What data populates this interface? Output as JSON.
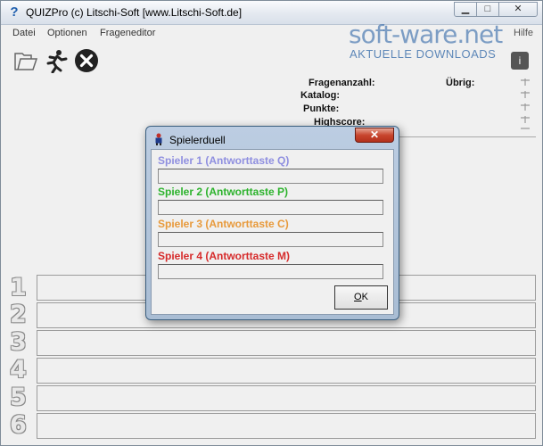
{
  "window": {
    "title": "QUIZPro (c) Litschi-Soft [www.Litschi-Soft.de]",
    "minimize_glyph": "▁",
    "maximize_glyph": "□",
    "close_glyph": "✕"
  },
  "menu": [
    "Datei",
    "Optionen",
    "Frageneditor"
  ],
  "help_menu_partial": "Hilfe",
  "watermark": {
    "brand": "soft-ware.net",
    "tagline": "AKTUELLE DOWNLOADS"
  },
  "stats": {
    "fragenanzahl": "Fragenanzahl:",
    "uebrig": "Übrig:",
    "katalog": "Katalog:",
    "punkte": "Punkte:",
    "highscore": "Highscore:"
  },
  "rows": [
    "1",
    "2",
    "3",
    "4",
    "5",
    "6"
  ],
  "dialog": {
    "title": "Spielerduell",
    "close_glyph": "✕",
    "players": [
      {
        "label": "Spieler 1 (Antworttaste Q)",
        "value": "",
        "color": "#8f8fe0"
      },
      {
        "label": "Spieler 2 (Antworttaste P)",
        "value": "",
        "color": "#2db32d"
      },
      {
        "label": "Spieler 3 (Antworttaste C)",
        "value": "",
        "color": "#e89a3c"
      },
      {
        "label": "Spieler 4 (Antworttaste M)",
        "value": "",
        "color": "#d62b2b"
      }
    ],
    "ok_accel": "O",
    "ok_rest": "K"
  },
  "icons": [
    "folder-open-icon",
    "runner-icon",
    "exit-icon",
    "info-icon"
  ],
  "info_glyph": "i"
}
